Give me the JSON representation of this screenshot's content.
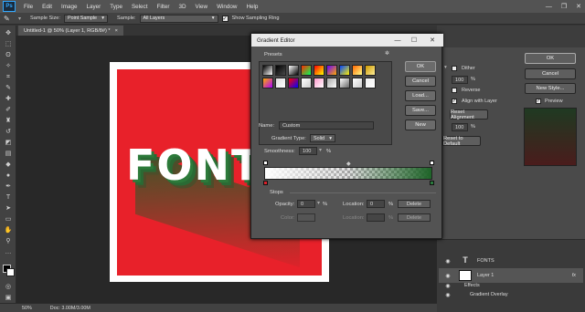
{
  "app": {
    "logo": "Ps",
    "minimize": "—",
    "restore": "❐",
    "close": "✕"
  },
  "menu": [
    "File",
    "Edit",
    "Image",
    "Layer",
    "Type",
    "Select",
    "Filter",
    "3D",
    "View",
    "Window",
    "Help"
  ],
  "options_bar": {
    "sample_size_label": "Sample Size:",
    "sample_size_value": "Point Sample",
    "sample_label": "Sample:",
    "sample_value": "All Layers",
    "show_ring_label": "Show Sampling Ring"
  },
  "document": {
    "tab_title": "Untitled-1 @ 50% (Layer 1, RGB/8#) *",
    "tab_close": "×",
    "canvas_text": "FONT"
  },
  "status": {
    "zoom": "50%",
    "doc": "Doc: 3.00M/3.00M"
  },
  "gradient_editor": {
    "title": "Gradient Editor",
    "presets_label": "Presets",
    "buttons": {
      "ok": "OK",
      "cancel": "Cancel",
      "load": "Load...",
      "save": "Save...",
      "new": "New"
    },
    "name_label": "Name:",
    "name_value": "Custom",
    "type_label": "Gradient Type:",
    "type_value": "Solid",
    "smoothness_label": "Smoothness:",
    "smoothness_value": "100",
    "percent": "%",
    "stops_label": "Stops",
    "opacity_label": "Opacity:",
    "opacity_value": "0",
    "location_label": "Location:",
    "location_value": "0",
    "color_label": "Color:",
    "delete_label": "Delete",
    "presets": [
      {
        "a": "#000000",
        "b": "#ffffff"
      },
      {
        "a": "#000000",
        "b": "#00000000"
      },
      {
        "a": "#ffffff",
        "b": "#000000"
      },
      {
        "a": "#ff2a00",
        "b": "#00ff55"
      },
      {
        "a": "#ff0000",
        "b": "#ffff00"
      },
      {
        "a": "#6600ff",
        "b": "#ffaa00"
      },
      {
        "a": "#0044ff",
        "b": "#ffee00"
      },
      {
        "a": "#ff6600",
        "b": "#ffff88"
      },
      {
        "a": "#cc9900",
        "b": "#ffee99"
      },
      {
        "a": "#ffaa00",
        "b": "#aa00ff"
      },
      {
        "a": "#dddddd",
        "b": "#ffffff"
      },
      {
        "a": "#ff0000",
        "b": "#0000ff"
      },
      {
        "a": "#ffffff",
        "b": "#cccccc"
      },
      {
        "a": "#ff99cc",
        "b": "#ffffff"
      },
      {
        "a": "#aaaaaa",
        "b": "#ffffff"
      },
      {
        "a": "#ffffff",
        "b": "#666666"
      },
      {
        "a": "#ffffff",
        "b": "#cccccc"
      },
      {
        "a": "#eeeeee",
        "b": "#ffffff"
      }
    ]
  },
  "layer_style": {
    "ok": "OK",
    "cancel": "Cancel",
    "new_style": "New Style...",
    "preview_label": "Preview",
    "dither": "Dither",
    "opacity_value": "100",
    "percent": "%",
    "reverse": "Reverse",
    "align": "Align with Layer",
    "reset_alignment": "Reset Alignment",
    "scale_value": "100",
    "reset_default": "Reset to Default"
  },
  "layers": {
    "fonts_label": "FONTS",
    "layer1_label": "Layer 1",
    "fx": "fx",
    "effects_label": "Effects",
    "gradient_overlay_label": "Gradient Overlay"
  },
  "colors": {
    "canvas_red": "#e8212a",
    "dialog_bg": "#535353",
    "title_bg": "#e9e9e9"
  }
}
